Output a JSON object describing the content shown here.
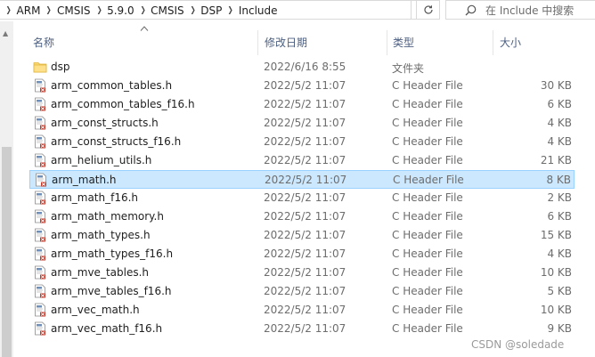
{
  "breadcrumbs": [
    "ARM",
    "CMSIS",
    "5.9.0",
    "CMSIS",
    "DSP",
    "Include"
  ],
  "search": {
    "placeholder": "在 Include 中搜索"
  },
  "columns": {
    "name": "名称",
    "date": "修改日期",
    "type": "类型",
    "size": "大小"
  },
  "files": [
    {
      "name": "dsp",
      "date": "2022/6/16 8:55",
      "type": "文件夹",
      "size": "",
      "kind": "folder-icon"
    },
    {
      "name": "arm_common_tables.h",
      "date": "2022/5/2 11:07",
      "type": "C Header File",
      "size": "30 KB",
      "kind": "h-file-icon"
    },
    {
      "name": "arm_common_tables_f16.h",
      "date": "2022/5/2 11:07",
      "type": "C Header File",
      "size": "6 KB",
      "kind": "h-file-icon"
    },
    {
      "name": "arm_const_structs.h",
      "date": "2022/5/2 11:07",
      "type": "C Header File",
      "size": "4 KB",
      "kind": "h-file-icon"
    },
    {
      "name": "arm_const_structs_f16.h",
      "date": "2022/5/2 11:07",
      "type": "C Header File",
      "size": "4 KB",
      "kind": "h-file-icon"
    },
    {
      "name": "arm_helium_utils.h",
      "date": "2022/5/2 11:07",
      "type": "C Header File",
      "size": "21 KB",
      "kind": "h-file-icon"
    },
    {
      "name": "arm_math.h",
      "date": "2022/5/2 11:07",
      "type": "C Header File",
      "size": "8 KB",
      "kind": "h-file-icon",
      "selected": true
    },
    {
      "name": "arm_math_f16.h",
      "date": "2022/5/2 11:07",
      "type": "C Header File",
      "size": "2 KB",
      "kind": "h-file-icon"
    },
    {
      "name": "arm_math_memory.h",
      "date": "2022/5/2 11:07",
      "type": "C Header File",
      "size": "6 KB",
      "kind": "h-file-icon"
    },
    {
      "name": "arm_math_types.h",
      "date": "2022/5/2 11:07",
      "type": "C Header File",
      "size": "15 KB",
      "kind": "h-file-icon"
    },
    {
      "name": "arm_math_types_f16.h",
      "date": "2022/5/2 11:07",
      "type": "C Header File",
      "size": "4 KB",
      "kind": "h-file-icon"
    },
    {
      "name": "arm_mve_tables.h",
      "date": "2022/5/2 11:07",
      "type": "C Header File",
      "size": "10 KB",
      "kind": "h-file-icon"
    },
    {
      "name": "arm_mve_tables_f16.h",
      "date": "2022/5/2 11:07",
      "type": "C Header File",
      "size": "5 KB",
      "kind": "h-file-icon"
    },
    {
      "name": "arm_vec_math.h",
      "date": "2022/5/2 11:07",
      "type": "C Header File",
      "size": "10 KB",
      "kind": "h-file-icon"
    },
    {
      "name": "arm_vec_math_f16.h",
      "date": "2022/5/2 11:07",
      "type": "C Header File",
      "size": "9 KB",
      "kind": "h-file-icon"
    }
  ],
  "watermark": "CSDN @soledade",
  "colors": {
    "selection_bg": "#cce8ff",
    "selection_border": "#99d1ff",
    "header_text": "#4d6082",
    "folder": "#f8d775"
  }
}
